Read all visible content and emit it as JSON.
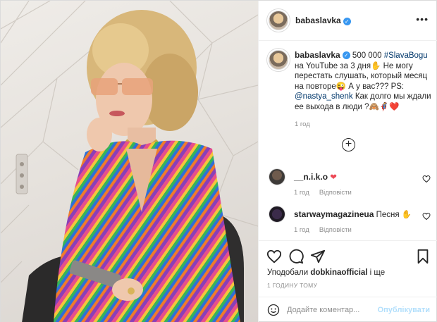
{
  "post": {
    "username": "babaslavka",
    "caption_prefix": "500 000 ",
    "hashtag": "#SlavaBogu",
    "caption_mid": " на YouTube за 3 дня✋ Не могу перестать слушать, который месяц на повторе😜 А у вас??? PS: ",
    "mention": "@nastya_shenk",
    "caption_suffix": " Как долго мы ждали ее выхода в люди ?🙈🦸‍♀️❤️",
    "caption_time": "1 год"
  },
  "comments": [
    {
      "username": "__n.i.k.o",
      "text": "❤",
      "time": "1 год",
      "reply_label": "Відповісти"
    },
    {
      "username": "starwaymagazineua",
      "text": "Песня ✋",
      "time": "1 год",
      "reply_label": "Відповісти"
    }
  ],
  "likes": {
    "prefix": "Уподобали ",
    "user": "dobkinaofficial",
    "suffix": " і ще"
  },
  "timestamp": "1 ГОДИНУ ТОМУ",
  "comment_box": {
    "placeholder": "Додайте коментар...",
    "publish_label": "Опублікувати"
  },
  "icons": {
    "header_more": "more-horizontal-icon",
    "add_more_comments": "plus-circle-icon",
    "like": "heart-icon",
    "comment": "comment-bubble-icon",
    "share": "paper-plane-icon",
    "save": "bookmark-icon",
    "emoji": "smiley-icon"
  },
  "colors": {
    "link": "#00376b",
    "verified": "#3897f0",
    "muted": "#8e8e8e",
    "publish_disabled": "#b2dffc",
    "heart": "#ed4956"
  }
}
